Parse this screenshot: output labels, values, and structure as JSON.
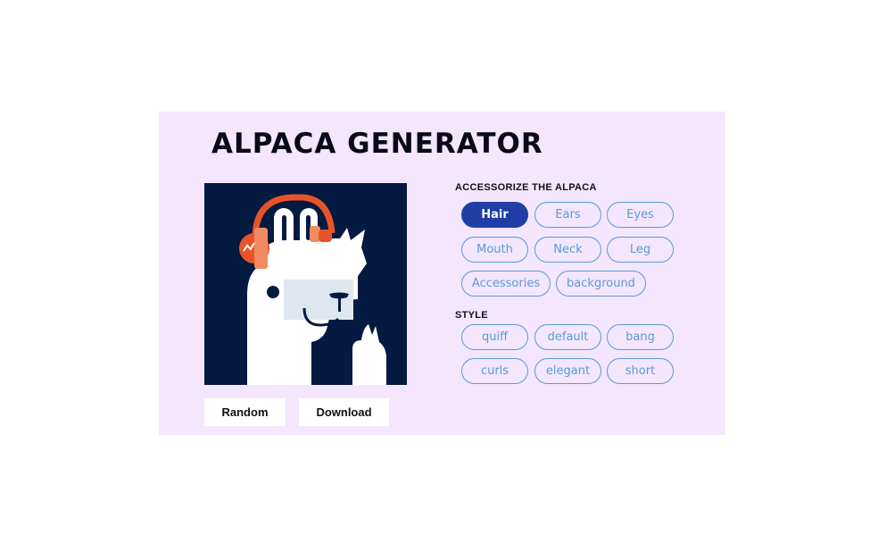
{
  "app": {
    "title": "ALPACA GENERATOR"
  },
  "actions": {
    "random_label": "Random",
    "download_label": "Download"
  },
  "accessorize": {
    "heading": "ACCESSORIZE THE ALPACA",
    "items": [
      {
        "label": "Hair",
        "active": true
      },
      {
        "label": "Ears",
        "active": false
      },
      {
        "label": "Eyes",
        "active": false
      },
      {
        "label": "Mouth",
        "active": false
      },
      {
        "label": "Neck",
        "active": false
      },
      {
        "label": "Leg",
        "active": false
      },
      {
        "label": "Accessories",
        "active": false
      },
      {
        "label": "background",
        "active": false
      }
    ]
  },
  "style": {
    "heading": "STYLE",
    "items": [
      {
        "label": "quiff"
      },
      {
        "label": "default"
      },
      {
        "label": "bang"
      },
      {
        "label": "curls"
      },
      {
        "label": "elegant"
      },
      {
        "label": "short"
      }
    ]
  },
  "colors": {
    "panel_bg": "#f3e6fd",
    "preview_bg": "#041a40",
    "accent_active": "#1f3ea6",
    "chip_outline": "#5b9bd5",
    "headphones": "#e8542a",
    "headphone_pad": "#f28a62"
  }
}
